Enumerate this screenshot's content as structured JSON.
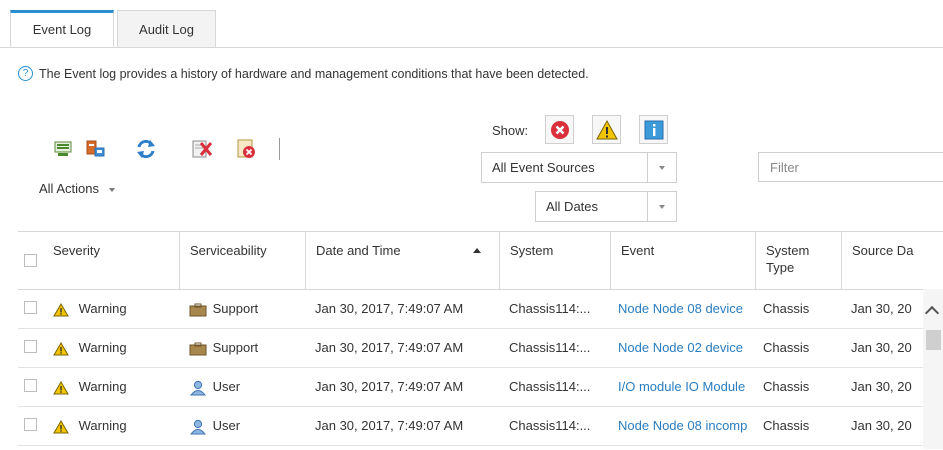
{
  "tabs": [
    {
      "label": "Event Log",
      "active": true
    },
    {
      "label": "Audit Log",
      "active": false
    }
  ],
  "info_text": "The Event log provides a history of hardware and management conditions that have been detected.",
  "toolbar": {
    "icons": [
      "server-icon",
      "dashboard-icon",
      "refresh-icon",
      "clear-log-icon",
      "exclude-events-icon"
    ],
    "all_actions_label": "All Actions"
  },
  "filters": {
    "show_label": "Show:",
    "show_buttons": [
      "error-filter-icon",
      "warning-filter-icon",
      "info-filter-icon"
    ],
    "source_value": "All Event Sources",
    "date_value": "All Dates",
    "filter_placeholder": "Filter"
  },
  "table": {
    "columns": [
      "Severity",
      "Serviceability",
      "Date and Time",
      "System",
      "Event",
      "System Type",
      "Source Da"
    ],
    "rows": [
      {
        "severity": "Warning",
        "serviceability": "Support",
        "date": "Jan 30, 2017, 7:49:07 AM",
        "system": "Chassis114:...",
        "event": "Node Node 08 device",
        "system_type": "Chassis",
        "source_date": "Jan 30, 20"
      },
      {
        "severity": "Warning",
        "serviceability": "Support",
        "date": "Jan 30, 2017, 7:49:07 AM",
        "system": "Chassis114:...",
        "event": "Node Node 02 device",
        "system_type": "Chassis",
        "source_date": "Jan 30, 20"
      },
      {
        "severity": "Warning",
        "serviceability": "User",
        "date": "Jan 30, 2017, 7:49:07 AM",
        "system": "Chassis114:...",
        "event": "I/O module IO Module",
        "system_type": "Chassis",
        "source_date": "Jan 30, 20"
      },
      {
        "severity": "Warning",
        "serviceability": "User",
        "date": "Jan 30, 2017, 7:49:07 AM",
        "system": "Chassis114:...",
        "event": "Node Node 08 incomp",
        "system_type": "Chassis",
        "source_date": "Jan 30, 20"
      }
    ]
  },
  "colors": {
    "accent": "#2a8fd0",
    "link": "#2a7dc0",
    "warning": "#f2c500",
    "error": "#d9303c"
  }
}
